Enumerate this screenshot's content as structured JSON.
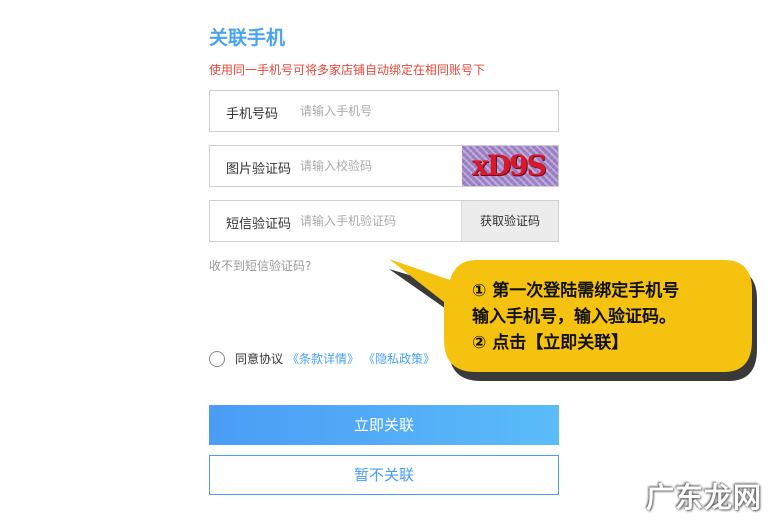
{
  "header": {
    "title": "关联手机",
    "subtitle": "使用同一手机号可将多家店铺自动绑定在相同账号下"
  },
  "form": {
    "phone": {
      "label": "手机号码",
      "placeholder": "请输入手机号"
    },
    "captcha": {
      "label": "图片验证码",
      "placeholder": "请输入校验码",
      "image_text": "xD9S"
    },
    "sms": {
      "label": "短信验证码",
      "placeholder": "请输入手机验证码",
      "button": "获取验证码"
    },
    "no_sms_link": "收不到短信验证码?",
    "agreement": {
      "text": "同意协议",
      "terms": "《条款详情》",
      "privacy": "《隐私政策》"
    }
  },
  "buttons": {
    "confirm": "立即关联",
    "skip": "暂不关联"
  },
  "callout": {
    "line1": "① 第一次登陆需绑定手机号",
    "line2": "输入手机号，输入验证码。",
    "line3": "② 点击【立即关联】",
    "fill_color": "#f5c30f"
  },
  "watermark": "广东龙网",
  "colors": {
    "accent": "#4aa3f0",
    "warning": "#e8463a"
  }
}
